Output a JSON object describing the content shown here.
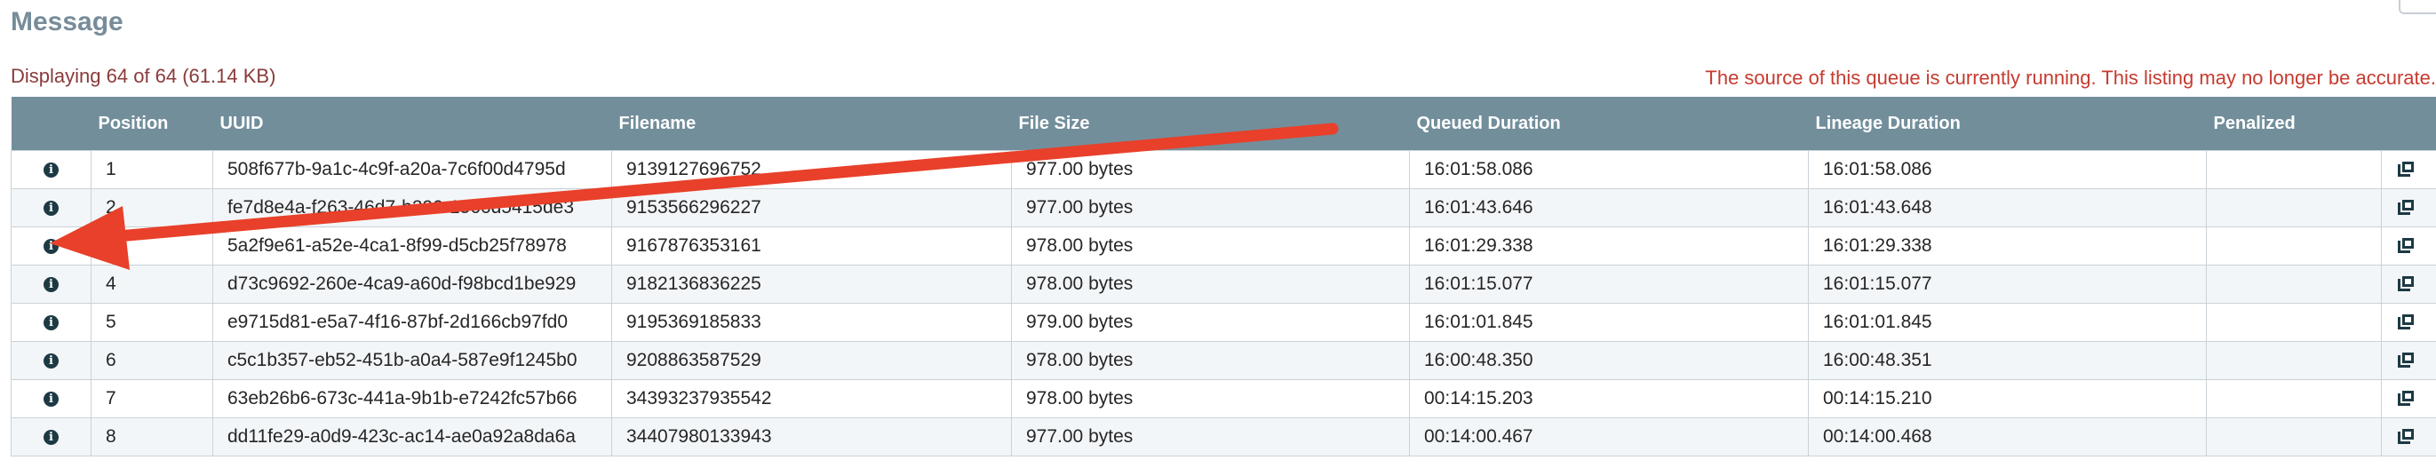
{
  "header": {
    "title": "Message",
    "count_text": "Displaying 64 of 64 (61.14 KB)",
    "warning_text": "The source of this queue is currently running. This listing may no longer be accurate."
  },
  "table": {
    "columns": [
      "",
      "Position",
      "UUID",
      "Filename",
      "File Size",
      "Queued Duration",
      "Lineage Duration",
      "Penalized",
      ""
    ],
    "rows": [
      {
        "position": "1",
        "uuid": "508f677b-9a1c-4c9f-a20a-7c6f00d4795d",
        "filename": "9139127696752",
        "size": "977.00 bytes",
        "queued": "16:01:58.086",
        "lineage": "16:01:58.086",
        "penalized": ""
      },
      {
        "position": "2",
        "uuid": "fe7d8e4a-f263-46d7-b290-1566d5415de3",
        "filename": "9153566296227",
        "size": "977.00 bytes",
        "queued": "16:01:43.646",
        "lineage": "16:01:43.648",
        "penalized": ""
      },
      {
        "position": "3",
        "uuid": "5a2f9e61-a52e-4ca1-8f99-d5cb25f78978",
        "filename": "9167876353161",
        "size": "978.00 bytes",
        "queued": "16:01:29.338",
        "lineage": "16:01:29.338",
        "penalized": ""
      },
      {
        "position": "4",
        "uuid": "d73c9692-260e-4ca9-a60d-f98bcd1be929",
        "filename": "9182136836225",
        "size": "978.00 bytes",
        "queued": "16:01:15.077",
        "lineage": "16:01:15.077",
        "penalized": ""
      },
      {
        "position": "5",
        "uuid": "e9715d81-e5a7-4f16-87bf-2d166cb97fd0",
        "filename": "9195369185833",
        "size": "979.00 bytes",
        "queued": "16:01:01.845",
        "lineage": "16:01:01.845",
        "penalized": ""
      },
      {
        "position": "6",
        "uuid": "c5c1b357-eb52-451b-a0a4-587e9f1245b0",
        "filename": "9208863587529",
        "size": "978.00 bytes",
        "queued": "16:00:48.350",
        "lineage": "16:00:48.351",
        "penalized": ""
      },
      {
        "position": "7",
        "uuid": "63eb26b6-673c-441a-9b1b-e7242fc57b66",
        "filename": "34393237935542",
        "size": "978.00 bytes",
        "queued": "00:14:15.203",
        "lineage": "00:14:15.210",
        "penalized": ""
      },
      {
        "position": "8",
        "uuid": "dd11fe29-a0d9-423c-ac14-ae0a92a8da6a",
        "filename": "34407980133943",
        "size": "977.00 bytes",
        "queued": "00:14:00.467",
        "lineage": "00:14:00.468",
        "penalized": ""
      }
    ]
  },
  "icons": {
    "row_details": "info-icon",
    "row_action": "provenance-icon"
  },
  "colors": {
    "header_bg": "#728e9b",
    "title": "#778c9a",
    "warning": "#c53b30",
    "count": "#8b3a3a",
    "annotation_arrow": "#e8402a"
  }
}
